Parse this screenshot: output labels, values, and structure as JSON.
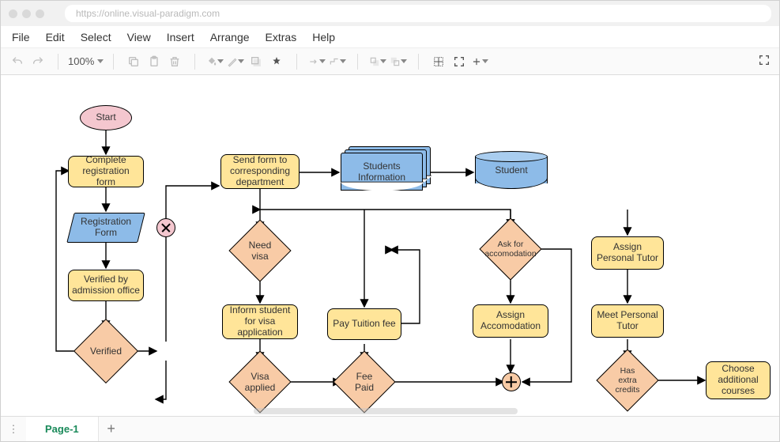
{
  "browser": {
    "url": "https://online.visual-paradigm.com"
  },
  "menu": [
    "File",
    "Edit",
    "Select",
    "View",
    "Insert",
    "Arrange",
    "Extras",
    "Help"
  ],
  "toolbar": {
    "zoom": "100%"
  },
  "tabs": {
    "page1": "Page-1"
  },
  "nodes": {
    "start": "Start",
    "complete_reg": "Complete registration form",
    "reg_form": "Registration Form",
    "verified_by": "Verified by admission office",
    "verified": "Verified",
    "send_form": "Send form to corresponding department",
    "students_info": "Students Information",
    "student": "Student",
    "need_visa": "Need visa",
    "inform_visa": "Inform student for visa application",
    "visa_applied": "Visa applied",
    "pay_tuition": "Pay Tuition fee",
    "fee_paid": "Fee Paid",
    "ask_accom": "Ask for accomodation",
    "assign_accom": "Assign Accomodation",
    "assign_tutor": "Assign Personal Tutor",
    "meet_tutor": "Meet Personal Tutor",
    "has_credits": "Has extra credits",
    "choose_courses": "Choose additional courses"
  }
}
